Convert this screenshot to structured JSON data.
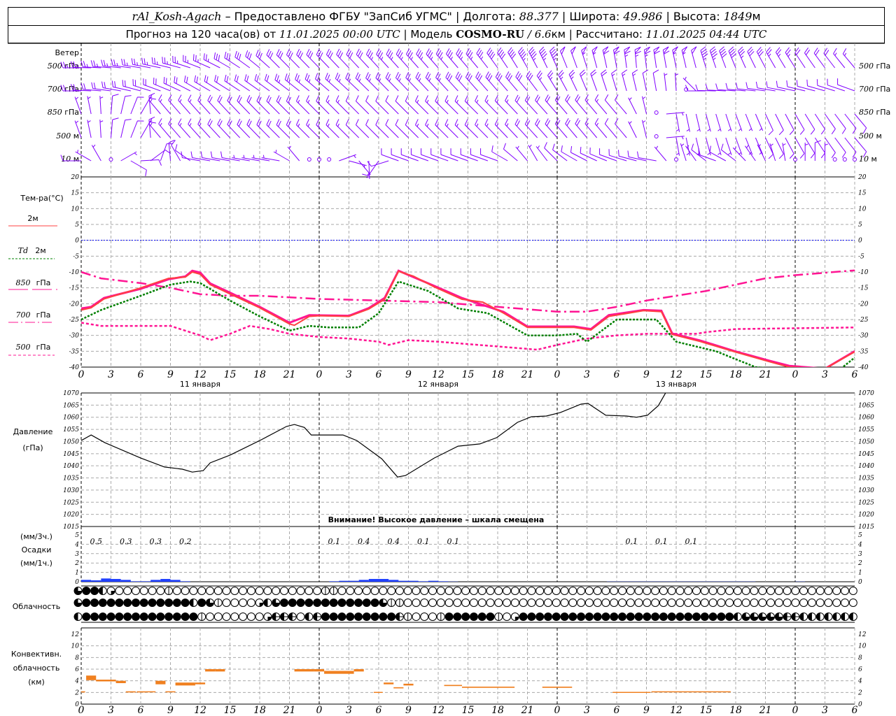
{
  "header": {
    "station": "rAl_Kosh-Agach",
    "provider": " – Предоставлено ФГБУ \"ЗапСиб УГМС\" | Долгота: ",
    "lon": "88.377",
    "lat_label": " | Широта: ",
    "lat": "49.986",
    "alt_label": " | Высота: ",
    "alt": "1849",
    "alt_unit": "м",
    "forecast_label": "Прогноз на 120 часа(ов) от ",
    "forecast_start": "11.01.2025 00:00 UTC",
    "model_label": " | Модель ",
    "model": "COSMO-RU",
    "resolution": " / 6.6",
    "res_unit": "км",
    "calc_label": " | Рассчитано: ",
    "calc_time": "11.01.2025 04:44 UTC"
  },
  "colors": {
    "wind": "#8000ff",
    "t2m": "#ff4040",
    "td": "#008000",
    "t850": "#ff1493",
    "t700": "#ff1493",
    "t500": "#ff1493",
    "zero": "#0000ff",
    "precip": "#2040ff",
    "conv": "#f08020"
  },
  "wind": {
    "title": "Ветер",
    "levels": [
      {
        "label_num": "500",
        "label_unit": " гПа",
        "keys": [
          [
            0,
            270,
            25
          ],
          [
            10,
            285,
            25
          ],
          [
            20,
            315,
            30
          ],
          [
            40,
            320,
            35
          ],
          [
            50,
            340,
            50
          ],
          [
            56,
            355,
            65
          ],
          [
            62,
            345,
            50
          ],
          [
            70,
            330,
            25
          ],
          [
            78,
            320,
            15
          ]
        ]
      },
      {
        "label_num": "700",
        "label_unit": " гПа",
        "keys": [
          [
            0,
            270,
            20
          ],
          [
            12,
            300,
            20
          ],
          [
            30,
            315,
            25
          ],
          [
            45,
            320,
            30
          ],
          [
            52,
            340,
            20
          ],
          [
            58,
            350,
            10
          ],
          [
            61,
            0,
            2
          ],
          [
            63,
            270,
            10
          ],
          [
            78,
            290,
            10
          ]
        ]
      },
      {
        "label_num": "850",
        "label_unit": " гПа",
        "keys": [
          [
            0,
            340,
            5
          ],
          [
            6,
            30,
            10
          ],
          [
            8,
            320,
            15
          ],
          [
            20,
            315,
            20
          ],
          [
            30,
            315,
            10
          ],
          [
            40,
            315,
            15
          ],
          [
            50,
            320,
            20
          ],
          [
            55,
            320,
            10
          ],
          [
            58,
            0,
            2
          ],
          [
            60,
            170,
            5
          ],
          [
            78,
            140,
            10
          ]
        ]
      },
      {
        "label_num": "500",
        "label_unit": " м",
        "keys": [
          [
            0,
            340,
            5
          ],
          [
            6,
            30,
            10
          ],
          [
            8,
            320,
            15
          ],
          [
            20,
            315,
            20
          ],
          [
            30,
            315,
            10
          ],
          [
            40,
            315,
            15
          ],
          [
            50,
            320,
            20
          ],
          [
            55,
            320,
            10
          ],
          [
            58,
            0,
            2
          ],
          [
            60,
            170,
            5
          ],
          [
            78,
            140,
            10
          ]
        ]
      },
      {
        "label_num": "10",
        "label_unit": "  м",
        "keys": [
          [
            0,
            270,
            8
          ],
          [
            3,
            0,
            2
          ],
          [
            5,
            120,
            8
          ],
          [
            8,
            20,
            8
          ],
          [
            12,
            280,
            10
          ],
          [
            20,
            280,
            5
          ],
          [
            24,
            0,
            2
          ],
          [
            28,
            140,
            5
          ],
          [
            32,
            290,
            10
          ],
          [
            42,
            290,
            10
          ],
          [
            46,
            330,
            5
          ],
          [
            50,
            300,
            10
          ],
          [
            58,
            280,
            10
          ],
          [
            60,
            0,
            2
          ],
          [
            64,
            290,
            10
          ],
          [
            72,
            0,
            2
          ],
          [
            74,
            0,
            10
          ],
          [
            76,
            0,
            2
          ],
          [
            78,
            0,
            2
          ]
        ]
      }
    ]
  },
  "temperature": {
    "title": "Тем-ра(°C)",
    "legend": [
      {
        "num": "",
        "label": "2м"
      },
      {
        "num": "Td",
        "label": " 2м"
      },
      {
        "num": "850",
        "label": " гПа"
      },
      {
        "num": "700",
        "label": " гПа"
      },
      {
        "num": "500",
        "label": " гПа"
      }
    ],
    "ticks": [
      "20",
      "15",
      "10",
      "5",
      "0",
      "-5",
      "-10",
      "-15",
      "-20",
      "-25",
      "-30",
      "-35",
      "-40"
    ],
    "t2m": [
      [
        0,
        -22
      ],
      [
        1,
        -21.3
      ],
      [
        2.3,
        -18.5
      ],
      [
        6,
        -15
      ],
      [
        8.8,
        -12
      ],
      [
        10.5,
        -11.6
      ],
      [
        11.2,
        -10
      ],
      [
        12,
        -10.7
      ],
      [
        13,
        -14
      ],
      [
        15,
        -16.9
      ],
      [
        18,
        -21.3
      ],
      [
        21,
        -26.4
      ],
      [
        21.5,
        -26.8
      ],
      [
        23,
        -24
      ],
      [
        24,
        -23.8
      ],
      [
        27,
        -24
      ],
      [
        29,
        -21.7
      ],
      [
        30.6,
        -18.6
      ],
      [
        32,
        -9.8
      ],
      [
        33.5,
        -11.3
      ],
      [
        35.6,
        -14.7
      ],
      [
        38.4,
        -18.6
      ],
      [
        40.5,
        -19.5
      ],
      [
        42.6,
        -23
      ],
      [
        45,
        -27.5
      ],
      [
        47.6,
        -27.5
      ],
      [
        49.7,
        -27.5
      ],
      [
        51.4,
        -28.3
      ],
      [
        53.2,
        -24
      ],
      [
        56.7,
        -22.2
      ],
      [
        58.5,
        -22.5
      ],
      [
        59.6,
        -29.7
      ],
      [
        62.4,
        -31.9
      ],
      [
        65.9,
        -35.2
      ],
      [
        69.4,
        -38.3
      ],
      [
        71.4,
        -40
      ],
      [
        75,
        -40.5
      ],
      [
        78,
        -35.2
      ]
    ],
    "td2m": [
      [
        0,
        -25
      ],
      [
        2,
        -22
      ],
      [
        6,
        -17.5
      ],
      [
        9,
        -14
      ],
      [
        11,
        -13
      ],
      [
        12,
        -13.5
      ],
      [
        15,
        -19
      ],
      [
        18,
        -24
      ],
      [
        21,
        -28.5
      ],
      [
        23,
        -27
      ],
      [
        25,
        -27.5
      ],
      [
        28,
        -27.5
      ],
      [
        30,
        -23
      ],
      [
        32,
        -13
      ],
      [
        35,
        -16
      ],
      [
        38,
        -21.5
      ],
      [
        41,
        -23
      ],
      [
        45,
        -30
      ],
      [
        48,
        -30
      ],
      [
        50,
        -29.5
      ],
      [
        51,
        -32
      ],
      [
        54,
        -25
      ],
      [
        58,
        -25
      ],
      [
        60,
        -32
      ],
      [
        64,
        -35
      ],
      [
        68,
        -40
      ],
      [
        76,
        -42
      ],
      [
        78,
        -37
      ]
    ],
    "t850": [
      [
        0,
        -21.5
      ],
      [
        1,
        -21
      ],
      [
        2.3,
        -18.2
      ],
      [
        6,
        -15.3
      ],
      [
        8.8,
        -12.3
      ],
      [
        10.5,
        -11.4
      ],
      [
        11.2,
        -9.6
      ],
      [
        12,
        -10.2
      ],
      [
        13,
        -13.6
      ],
      [
        15,
        -16.5
      ],
      [
        18,
        -21
      ],
      [
        21,
        -26
      ],
      [
        23,
        -23.6
      ],
      [
        27,
        -23.8
      ],
      [
        29,
        -21.4
      ],
      [
        30.6,
        -18.2
      ],
      [
        32,
        -9.6
      ],
      [
        35.6,
        -14.4
      ],
      [
        38.4,
        -18.2
      ],
      [
        42.6,
        -22.6
      ],
      [
        45,
        -27.2
      ],
      [
        49.7,
        -27.2
      ],
      [
        51.4,
        -28
      ],
      [
        53.2,
        -23.6
      ],
      [
        56.7,
        -22
      ],
      [
        58.5,
        -22.2
      ],
      [
        59.6,
        -29.4
      ],
      [
        62.4,
        -31.6
      ],
      [
        65.9,
        -35
      ],
      [
        69.4,
        -38
      ],
      [
        71.4,
        -39.6
      ],
      [
        75,
        -40.5
      ],
      [
        78,
        -35
      ]
    ],
    "t700": [
      [
        0,
        -10
      ],
      [
        2,
        -12
      ],
      [
        6,
        -13.5
      ],
      [
        9,
        -15
      ],
      [
        12,
        -17
      ],
      [
        15,
        -17.5
      ],
      [
        18,
        -17.5
      ],
      [
        24,
        -18.5
      ],
      [
        30,
        -19
      ],
      [
        36,
        -19.5
      ],
      [
        42,
        -21
      ],
      [
        48,
        -22.5
      ],
      [
        51,
        -22.5
      ],
      [
        54,
        -21
      ],
      [
        57,
        -19
      ],
      [
        63,
        -16
      ],
      [
        66,
        -14
      ],
      [
        69,
        -12
      ],
      [
        72,
        -11
      ],
      [
        78,
        -9.5
      ]
    ],
    "t500": [
      [
        0,
        -26
      ],
      [
        2,
        -27
      ],
      [
        6,
        -27
      ],
      [
        9,
        -27
      ],
      [
        12,
        -30
      ],
      [
        13,
        -31.5
      ],
      [
        15,
        -29.5
      ],
      [
        17,
        -27
      ],
      [
        19,
        -28
      ],
      [
        21,
        -29.5
      ],
      [
        24,
        -30.5
      ],
      [
        27,
        -31
      ],
      [
        30,
        -32
      ],
      [
        31,
        -33
      ],
      [
        33,
        -31.5
      ],
      [
        36,
        -32
      ],
      [
        42,
        -33.5
      ],
      [
        46,
        -34.5
      ],
      [
        48,
        -33
      ],
      [
        51,
        -31
      ],
      [
        54,
        -30
      ],
      [
        57,
        -29.5
      ],
      [
        62,
        -29.5
      ],
      [
        63,
        -29
      ],
      [
        66,
        -28
      ],
      [
        78,
        -27.5
      ]
    ]
  },
  "xaxis": {
    "hour_labels": [
      "0",
      "3",
      "6",
      "9",
      "12",
      "15",
      "18",
      "21",
      "0",
      "3",
      "6",
      "9",
      "12",
      "15",
      "18",
      "21",
      "0",
      "3",
      "6",
      "9",
      "12",
      "15",
      "18",
      "21",
      "0",
      "3",
      "6"
    ],
    "days": [
      "11 января",
      "12 января",
      "13 января"
    ]
  },
  "pressure": {
    "title": "Давление",
    "unit": "(гПа)",
    "ticks": [
      "1070",
      "1065",
      "1060",
      "1055",
      "1050",
      "1045",
      "1040",
      "1035",
      "1030",
      "1025",
      "1020",
      "1015"
    ],
    "warning": "Внимание! Высокое давление – шкала смещена",
    "series": [
      [
        0,
        1050.4
      ],
      [
        1,
        1052.7
      ],
      [
        2.4,
        1049.5
      ],
      [
        6,
        1043.2
      ],
      [
        8.4,
        1039.5
      ],
      [
        10.2,
        1038.6
      ],
      [
        11.2,
        1037.4
      ],
      [
        12.3,
        1038
      ],
      [
        13,
        1041.2
      ],
      [
        15,
        1044.4
      ],
      [
        18,
        1050.4
      ],
      [
        20.7,
        1056.2
      ],
      [
        21.5,
        1057
      ],
      [
        22.5,
        1055.8
      ],
      [
        23.2,
        1052.7
      ],
      [
        26.4,
        1052.7
      ],
      [
        27.8,
        1050.4
      ],
      [
        30.3,
        1042.9
      ],
      [
        31.9,
        1035.4
      ],
      [
        32.7,
        1036
      ],
      [
        35.6,
        1043.2
      ],
      [
        38,
        1048.1
      ],
      [
        40.2,
        1049
      ],
      [
        41.9,
        1051.6
      ],
      [
        44,
        1057.9
      ],
      [
        45.4,
        1060.2
      ],
      [
        46.9,
        1060.5
      ],
      [
        48.3,
        1061.9
      ],
      [
        50.4,
        1065.4
      ],
      [
        51.1,
        1065.7
      ],
      [
        52.9,
        1060.8
      ],
      [
        55,
        1060.5
      ],
      [
        56,
        1060
      ],
      [
        57.1,
        1060.8
      ],
      [
        58.2,
        1064.8
      ],
      [
        59,
        1070.5
      ]
    ]
  },
  "precip": {
    "unit3h": "(мм/3ч.)",
    "title": "Осадки",
    "unit1h": "(мм/1ч.)",
    "ticks": [
      "5",
      "4",
      "3",
      "2",
      "1",
      "0"
    ],
    "hourly": [
      0.2,
      0.15,
      0.35,
      0.3,
      0.2,
      0.05,
      0.05,
      0.2,
      0.3,
      0.2,
      0.05,
      0,
      0,
      0,
      0,
      0,
      0,
      0,
      0,
      0,
      0,
      0,
      0,
      0,
      0,
      0.05,
      0.1,
      0.1,
      0.2,
      0.3,
      0.3,
      0.2,
      0.1,
      0.1,
      0.05,
      0.1,
      0.05,
      0.02,
      0,
      0,
      0,
      0,
      0,
      0,
      0,
      0,
      0,
      0,
      0,
      0,
      0,
      0,
      0,
      0.02,
      0.02,
      0.02,
      0.02,
      0.02,
      0.02,
      0.02,
      0.02,
      0.02,
      0.02,
      0.02,
      0.02,
      0.02,
      0.02,
      0.02,
      0,
      0,
      0,
      0,
      0.02,
      0,
      0,
      0,
      0,
      0
    ],
    "totals3h": [
      {
        "h": 1.5,
        "v": "0.5"
      },
      {
        "h": 4.5,
        "v": "0.3"
      },
      {
        "h": 7.5,
        "v": "0.3"
      },
      {
        "h": 10.5,
        "v": "0.2"
      },
      {
        "h": 25.5,
        "v": "0.1"
      },
      {
        "h": 28.5,
        "v": "0.4"
      },
      {
        "h": 31.5,
        "v": "0.4"
      },
      {
        "h": 34.5,
        "v": "0.1"
      },
      {
        "h": 37.5,
        "v": "0.1"
      },
      {
        "h": 55.5,
        "v": "0.1"
      },
      {
        "h": 58.5,
        "v": "0.1"
      },
      {
        "h": 61.5,
        "v": "0.1"
      }
    ]
  },
  "clouds": {
    "title": "Облачность",
    "rows": [
      "34421000000500000000000000000055000000000000000000000000000000000000000000000000000000000000000",
      "34444444444444243500001234444444444443550000000000000000000000000000000000000000000000000000000",
      "24444444444444450000000166602644444444465000544444450144444444444444444444444444233333662222222"
    ]
  },
  "convective": {
    "title1": "Конвективн.",
    "title2": "облачность",
    "unit": "(км)",
    "ticks": [
      "12",
      "10",
      "8",
      "6",
      "4",
      "2",
      "0"
    ],
    "segments": [
      [
        0,
        0.4,
        2.0,
        2.2
      ],
      [
        0.5,
        1.5,
        4.1,
        4.9
      ],
      [
        1.5,
        3.5,
        3.9,
        4.2
      ],
      [
        3.5,
        4.5,
        3.6,
        4.0
      ],
      [
        4.5,
        5.5,
        2.0,
        2.2
      ],
      [
        5.6,
        6.5,
        2.0,
        2.2
      ],
      [
        6.5,
        7.5,
        2.1,
        2.2
      ],
      [
        7.5,
        8.5,
        3.4,
        4.0
      ],
      [
        8.5,
        9.5,
        2.1,
        2.2
      ],
      [
        9.5,
        11.5,
        3.2,
        3.7
      ],
      [
        11.5,
        12.5,
        3.4,
        3.7
      ],
      [
        12.5,
        13.5,
        5.6,
        6.0
      ],
      [
        13.5,
        14.5,
        5.6,
        6.0
      ],
      [
        21.5,
        23.5,
        5.6,
        6.0
      ],
      [
        23.5,
        24.5,
        5.6,
        6.0
      ],
      [
        24.5,
        27.5,
        5.2,
        5.7
      ],
      [
        27.5,
        28.5,
        5.6,
        6.0
      ],
      [
        29.5,
        30.4,
        2.0,
        2.1
      ],
      [
        30.5,
        31.5,
        3.4,
        3.7
      ],
      [
        31.5,
        32.5,
        2.7,
        2.9
      ],
      [
        32.5,
        33.5,
        3.2,
        3.5
      ],
      [
        36.6,
        38.4,
        3.1,
        3.3
      ],
      [
        38.4,
        43.7,
        2.8,
        3.0
      ],
      [
        46.5,
        49.5,
        2.8,
        3.0
      ],
      [
        53.6,
        57.4,
        2.0,
        2.1
      ],
      [
        57.5,
        65.5,
        2.1,
        2.2
      ]
    ]
  }
}
